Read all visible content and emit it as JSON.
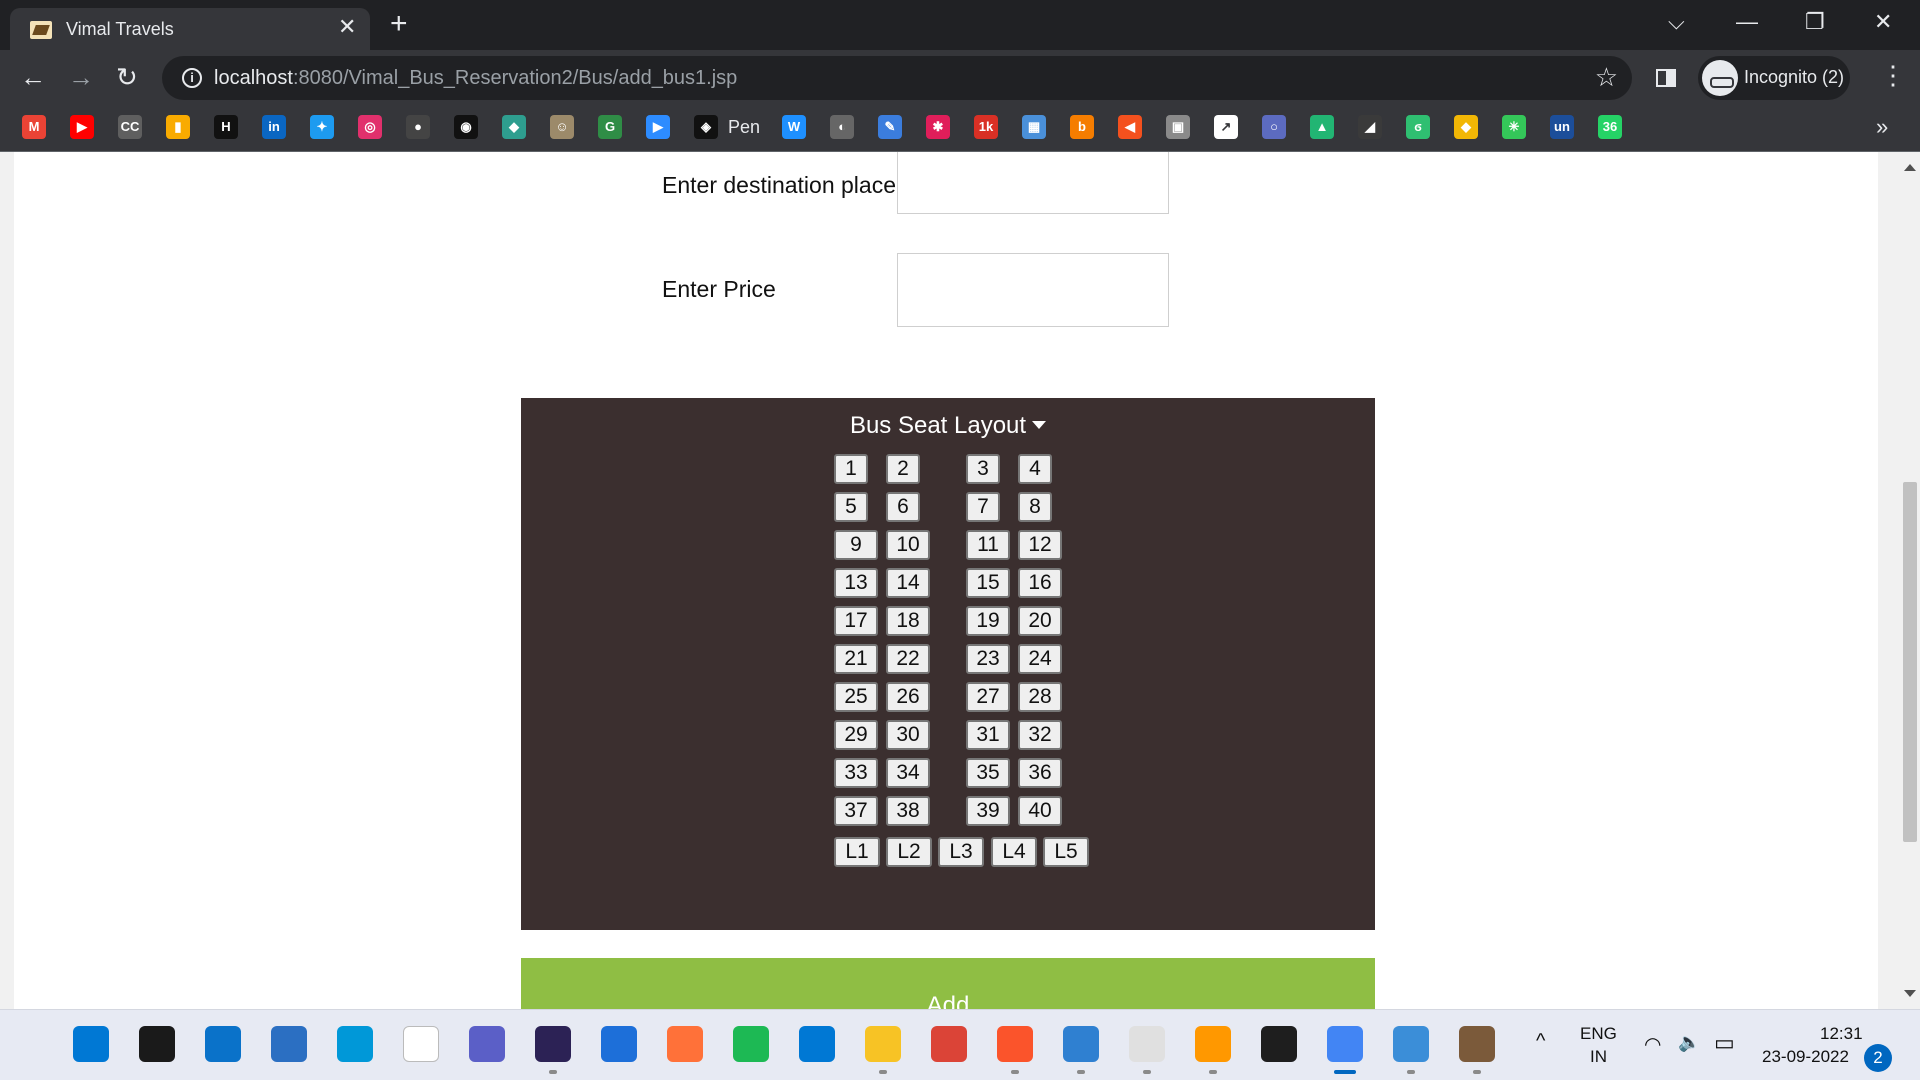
{
  "browser": {
    "tab_title": "Vimal Travels",
    "tab_close": "✕",
    "new_tab": "+",
    "url_host": "localhost",
    "url_rest": ":8080/Vimal_Bus_Reservation2/Bus/add_bus1.jsp",
    "info_glyph": "i",
    "incognito_label": "Incognito (2)",
    "back_glyph": "←",
    "forward_glyph": "→",
    "reload_glyph": "↻",
    "star_glyph": "☆",
    "menu_glyph": "⋮",
    "tabsearch_glyph": "⌵",
    "minimize_glyph": "—",
    "restore_glyph": "❐",
    "close_glyph": "✕"
  },
  "bookmarks": {
    "pen_label": "Pen",
    "more_glyph": "»",
    "icons": [
      {
        "name": "gmail-icon",
        "text": "M",
        "color": "#ea4335"
      },
      {
        "name": "youtube-icon",
        "text": "▶",
        "color": "#ff0000"
      },
      {
        "name": "cc-icon",
        "text": "CC",
        "color": "#5f5f5f"
      },
      {
        "name": "analytics-icon",
        "text": "▮",
        "color": "#f9ab00"
      },
      {
        "name": "hackerrank-icon",
        "text": "H",
        "color": "#111111"
      },
      {
        "name": "linkedin-icon",
        "text": "in",
        "color": "#0a66c2"
      },
      {
        "name": "twitter-icon",
        "text": "✦",
        "color": "#1d9bf0"
      },
      {
        "name": "instagram-icon",
        "text": "◎",
        "color": "#e1306c"
      },
      {
        "name": "github-icon",
        "text": "●",
        "color": "#444444"
      },
      {
        "name": "target-icon",
        "text": "◉",
        "color": "#111111"
      },
      {
        "name": "puzzle-icon",
        "text": "◆",
        "color": "#2e9e8f"
      },
      {
        "name": "avatar-bookmark-icon",
        "text": "☺",
        "color": "#9c8a6a"
      },
      {
        "name": "geeksforgeeks-icon",
        "text": "G",
        "color": "#2f8d46"
      },
      {
        "name": "zoom-icon",
        "text": "▶",
        "color": "#2d8cff"
      },
      {
        "name": "codepen-icon",
        "text": "◈",
        "color": "#111111"
      },
      {
        "name": "webflow-icon",
        "text": "W",
        "color": "#1e90ff"
      },
      {
        "name": "globe-icon",
        "text": "◐",
        "color": "#666666"
      },
      {
        "name": "pen-tool-icon",
        "text": "✎",
        "color": "#3b7ddd"
      },
      {
        "name": "slack-icon",
        "text": "✱",
        "color": "#e01e5a"
      },
      {
        "name": "notification-1k-icon",
        "text": "1k",
        "color": "#d93025"
      },
      {
        "name": "grid-icon",
        "text": "▦",
        "color": "#4a90d9"
      },
      {
        "name": "blogger-icon",
        "text": "b",
        "color": "#f57d00"
      },
      {
        "name": "arrow-icon",
        "text": "◀",
        "color": "#f4511e"
      },
      {
        "name": "image-icon",
        "text": "▣",
        "color": "#8a8a8a"
      },
      {
        "name": "chart-icon",
        "text": "↗",
        "color": "#ffffff"
      },
      {
        "name": "ring-icon",
        "text": "○",
        "color": "#5c6bc0"
      },
      {
        "name": "tree-icon",
        "text": "▲",
        "color": "#22b573"
      },
      {
        "name": "dark-logo-icon",
        "text": "◢",
        "color": "#3a3a3a"
      },
      {
        "name": "leaf-icon",
        "text": "ϭ",
        "color": "#2fbf71"
      },
      {
        "name": "gold-icon",
        "text": "◆",
        "color": "#f2b705"
      },
      {
        "name": "asterisk-icon",
        "text": "✳",
        "color": "#34c759"
      },
      {
        "name": "unstop-icon",
        "text": "un",
        "color": "#1c4e9a"
      },
      {
        "name": "badge-36-icon",
        "text": "36",
        "color": "#25d366"
      }
    ]
  },
  "form": {
    "destination_label": "Enter destination place",
    "price_label": "Enter Price"
  },
  "seat_layout": {
    "title": "Bus Seat Layout",
    "rows": [
      [
        "1",
        "2",
        "3",
        "4"
      ],
      [
        "5",
        "6",
        "7",
        "8"
      ],
      [
        "9",
        "10",
        "11",
        "12"
      ],
      [
        "13",
        "14",
        "15",
        "16"
      ],
      [
        "17",
        "18",
        "19",
        "20"
      ],
      [
        "21",
        "22",
        "23",
        "24"
      ],
      [
        "25",
        "26",
        "27",
        "28"
      ],
      [
        "29",
        "30",
        "31",
        "32"
      ],
      [
        "33",
        "34",
        "35",
        "36"
      ],
      [
        "37",
        "38",
        "39",
        "40"
      ]
    ],
    "last_row": [
      "L1",
      "L2",
      "L3",
      "L4",
      "L5"
    ]
  },
  "add_button_label": "Add",
  "taskbar": {
    "apps": [
      {
        "name": "start-icon",
        "color": "#0078d4"
      },
      {
        "name": "search-icon",
        "color": "#1a1a1a"
      },
      {
        "name": "desktop-icon",
        "color": "#0a72c9"
      },
      {
        "name": "store-icon",
        "color": "#2b6fc2"
      },
      {
        "name": "photos-icon",
        "color": "#0098d8"
      },
      {
        "name": "dare2compete-icon",
        "color": "#ffffff"
      },
      {
        "name": "teams-icon",
        "color": "#5b5fc7"
      },
      {
        "name": "eclipse-icon",
        "color": "#2c2255"
      },
      {
        "name": "whiteboard-icon",
        "color": "#1d6fd9"
      },
      {
        "name": "firefox-icon",
        "color": "#ff7139"
      },
      {
        "name": "spotify-icon",
        "color": "#1db954"
      },
      {
        "name": "vscode-icon",
        "color": "#0078d4"
      },
      {
        "name": "file-explorer-icon",
        "color": "#f7c325"
      },
      {
        "name": "chrome-icon",
        "color": "#db4437"
      },
      {
        "name": "brave-icon",
        "color": "#fb542b"
      },
      {
        "name": "notepad-icon",
        "color": "#2f80d1"
      },
      {
        "name": "java-icon",
        "color": "#e0e0e0"
      },
      {
        "name": "sublime-icon",
        "color": "#ff9800"
      },
      {
        "name": "terminal-icon",
        "color": "#1e1e1e"
      },
      {
        "name": "chrome-profile-icon",
        "color": "#4285f4"
      },
      {
        "name": "control-panel-icon",
        "color": "#3b8ed8"
      },
      {
        "name": "minecraft-icon",
        "color": "#7b5a3a"
      }
    ],
    "lang_top": "ENG",
    "lang_bottom": "IN",
    "time": "12:31",
    "date": "23-09-2022",
    "notification_count": "2",
    "tray_chevron": "^",
    "wifi_glyph": "◠",
    "volume_glyph": "🔈",
    "battery_glyph": "▭"
  }
}
